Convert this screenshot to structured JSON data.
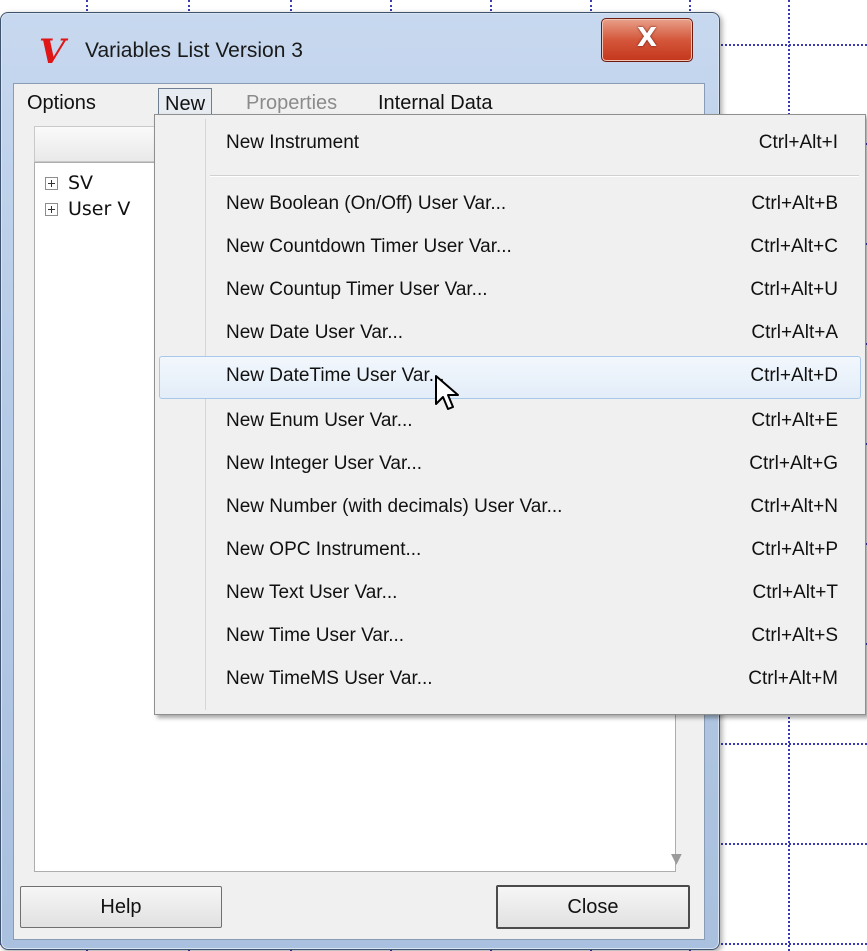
{
  "window": {
    "title": "Variables List Version 3",
    "icon": "v-logo-icon",
    "close_glyph": "X"
  },
  "menubar": {
    "options": "Options",
    "new": "New",
    "properties": "Properties",
    "internal_data": "Internal Data"
  },
  "tree": {
    "items": [
      {
        "label": "SV"
      },
      {
        "label": "User V"
      }
    ]
  },
  "buttons": {
    "help": "Help",
    "close": "Close"
  },
  "dropdown": {
    "items": [
      {
        "label": "New Instrument",
        "shortcut": "Ctrl+Alt+I"
      },
      {
        "label": "New Boolean (On/Off) User Var...",
        "shortcut": "Ctrl+Alt+B"
      },
      {
        "label": "New Countdown Timer User Var...",
        "shortcut": "Ctrl+Alt+C"
      },
      {
        "label": "New Countup Timer User Var...",
        "shortcut": "Ctrl+Alt+U"
      },
      {
        "label": "New Date User Var...",
        "shortcut": "Ctrl+Alt+A"
      },
      {
        "label": "New DateTime User Var...",
        "shortcut": "Ctrl+Alt+D"
      },
      {
        "label": "New Enum User Var...",
        "shortcut": "Ctrl+Alt+E"
      },
      {
        "label": "New Integer User Var...",
        "shortcut": "Ctrl+Alt+G"
      },
      {
        "label": "New Number (with decimals) User Var...",
        "shortcut": "Ctrl+Alt+N"
      },
      {
        "label": "New OPC Instrument...",
        "shortcut": "Ctrl+Alt+P"
      },
      {
        "label": "New Text User Var...",
        "shortcut": "Ctrl+Alt+T"
      },
      {
        "label": "New Time User Var...",
        "shortcut": "Ctrl+Alt+S"
      },
      {
        "label": "New TimeMS User Var...",
        "shortcut": "Ctrl+Alt+M"
      }
    ]
  },
  "colors": {
    "grid_line": "#3b3bb7",
    "close_button": "#c4361c",
    "logo": "#e01515",
    "hover_highlight": "#a8c8eb"
  }
}
